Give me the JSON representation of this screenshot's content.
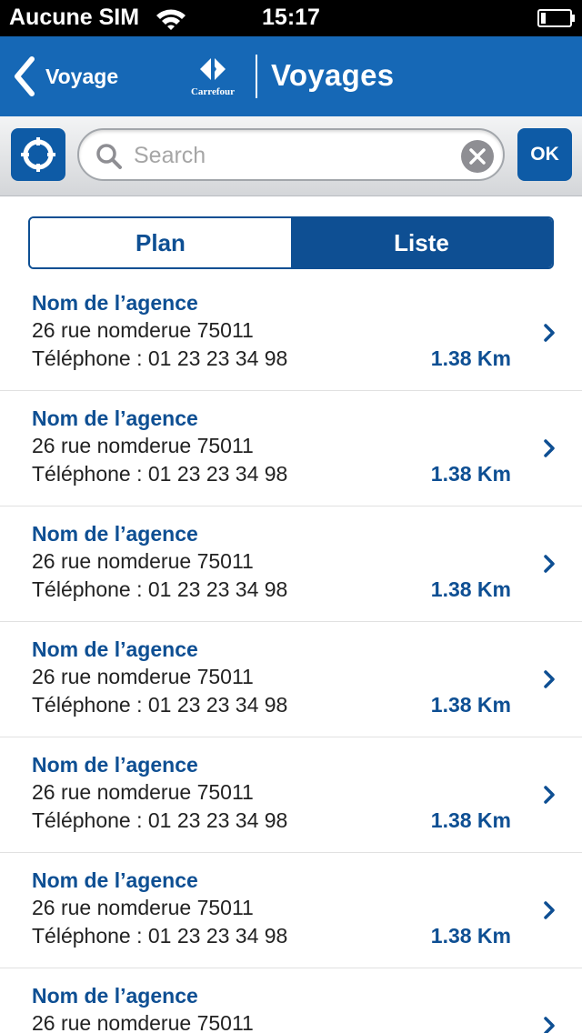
{
  "status_bar": {
    "carrier": "Aucune SIM",
    "time": "15:17"
  },
  "nav": {
    "back_label": "Voyage",
    "logo_text": "Carrefour",
    "title": "Voyages"
  },
  "search": {
    "placeholder": "Search",
    "value": "",
    "ok_label": "OK"
  },
  "segments": {
    "plan_label": "Plan",
    "liste_label": "Liste",
    "selected": "Liste"
  },
  "agencies": [
    {
      "name": "Nom de l’agence",
      "address": "26 rue nomderue 75011",
      "phone": "Téléphone : 01 23 23 34 98",
      "distance": "1.38 Km"
    },
    {
      "name": "Nom de l’agence",
      "address": "26 rue nomderue 75011",
      "phone": "Téléphone : 01 23 23 34 98",
      "distance": "1.38 Km"
    },
    {
      "name": "Nom de l’agence",
      "address": "26 rue nomderue 75011",
      "phone": "Téléphone : 01 23 23 34 98",
      "distance": "1.38 Km"
    },
    {
      "name": "Nom de l’agence",
      "address": "26 rue nomderue 75011",
      "phone": "Téléphone : 01 23 23 34 98",
      "distance": "1.38 Km"
    },
    {
      "name": "Nom de l’agence",
      "address": "26 rue nomderue 75011",
      "phone": "Téléphone : 01 23 23 34 98",
      "distance": "1.38 Km"
    },
    {
      "name": "Nom de l’agence",
      "address": "26 rue nomderue 75011",
      "phone": "Téléphone : 01 23 23 34 98",
      "distance": "1.38 Km"
    },
    {
      "name": "Nom de l’agence",
      "address": "26 rue nomderue 75011",
      "phone": "",
      "distance": ""
    }
  ],
  "colors": {
    "nav_blue": "#1668b6",
    "brand_dark_blue": "#0e4f93",
    "button_blue": "#0e5ba6"
  }
}
